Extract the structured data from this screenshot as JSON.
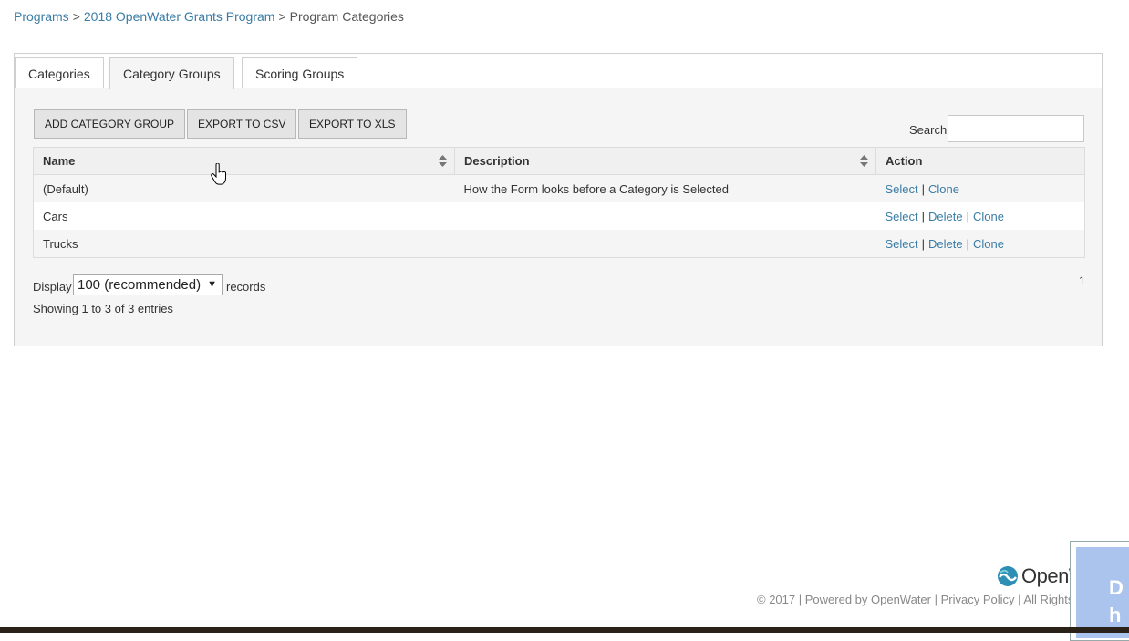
{
  "breadcrumb": {
    "items": [
      "Programs",
      "2018 OpenWater Grants Program"
    ],
    "current": "Program Categories",
    "separator": ">"
  },
  "tabs": [
    {
      "label": "Categories",
      "active": false
    },
    {
      "label": "Category Groups",
      "active": true
    },
    {
      "label": "Scoring Groups",
      "active": false
    }
  ],
  "toolbar": {
    "add_label": "ADD CATEGORY GROUP",
    "csv_label": "EXPORT TO CSV",
    "xls_label": "EXPORT TO XLS",
    "search_label": "Search:",
    "search_value": ""
  },
  "table": {
    "columns": [
      "Name",
      "Description",
      "Action"
    ],
    "rows": [
      {
        "name": "(Default)",
        "description": "How the Form looks before a Category is Selected",
        "actions": [
          "Select",
          "Clone"
        ]
      },
      {
        "name": "Cars",
        "description": "",
        "actions": [
          "Select",
          "Delete",
          "Clone"
        ]
      },
      {
        "name": "Trucks",
        "description": "",
        "actions": [
          "Select",
          "Delete",
          "Clone"
        ]
      }
    ]
  },
  "paging": {
    "display_label": "Display",
    "selected": "100 (recommended)",
    "records_label": "records",
    "showing": "Showing 1 to 3 of 3 entries",
    "page": "1"
  },
  "brand": {
    "name": "OpenWater"
  },
  "footer": {
    "copyright": "© 2017",
    "powered": "Powered by OpenWater",
    "privacy": "Privacy Policy",
    "rights": "All Rights Reserved."
  },
  "help_widget": {
    "text_line1": "D",
    "text_line2": "h"
  },
  "colors": {
    "link": "#3a7ca5",
    "panel_bg": "#f5f5f5",
    "button_bg": "#e4e4e4"
  }
}
